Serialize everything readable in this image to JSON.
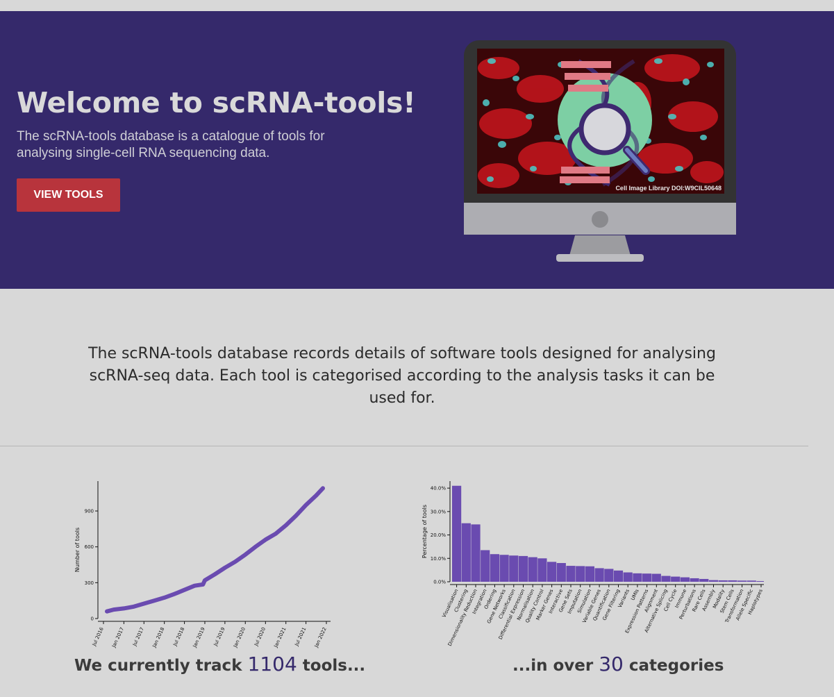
{
  "hero": {
    "title": "Welcome to scRNA-tools!",
    "description": "The scRNA-tools database is a catalogue of tools for analysing single-cell RNA sequencing data.",
    "button_label": "VIEW TOOLS",
    "image_credit": "Cell Image Library DOI:W9CIL50648",
    "background_color": "#35296b",
    "button_color": "#b8343c"
  },
  "intro": {
    "text": "The scRNA-tools database records details of software tools designed for analysing scRNA-seq data. Each tool is categorised according to the analysis tasks it can be used for."
  },
  "captions": {
    "tools_prefix": "We currently track ",
    "tools_count": "1104",
    "tools_suffix": " tools...",
    "categories_prefix": "...in over ",
    "categories_count": "30",
    "categories_suffix": " categories"
  },
  "chart_data": [
    {
      "type": "line",
      "ylabel": "Number of tools",
      "xlabel": "",
      "x_ticks": [
        "Jul 2016",
        "Jan 2017",
        "Jul 2017",
        "Jan 2018",
        "Jul 2018",
        "Jan 2019",
        "Jul 2019",
        "Jan 2020",
        "Jul 2020",
        "Jan 2021",
        "Jul 2021",
        "Jan 2022"
      ],
      "y_ticks": [
        "0",
        "300",
        "600",
        "900"
      ],
      "ylim": [
        0,
        1150
      ],
      "color": "#6a4bb0",
      "series": [
        {
          "x": [
            "2016-08-01",
            "2016-10-01",
            "2017-01-01",
            "2017-04-01",
            "2017-07-01",
            "2017-10-01",
            "2018-01-01",
            "2018-04-01",
            "2018-07-01",
            "2018-10-01",
            "2018-12-15",
            "2019-01-01",
            "2019-04-01",
            "2019-07-01",
            "2019-10-01",
            "2020-01-01",
            "2020-04-01",
            "2020-07-01",
            "2020-10-01",
            "2021-01-01",
            "2021-04-01",
            "2021-07-01",
            "2021-10-01",
            "2021-12-01"
          ],
          "y": [
            60,
            75,
            85,
            100,
            125,
            150,
            175,
            205,
            240,
            275,
            285,
            320,
            370,
            425,
            475,
            535,
            600,
            660,
            710,
            780,
            860,
            950,
            1030,
            1090
          ]
        }
      ]
    },
    {
      "type": "bar",
      "ylabel": "Percentage of tools",
      "xlabel": "",
      "y_ticks": [
        "0.0%",
        "10.0%",
        "20.0%",
        "30.0%",
        "40.0%"
      ],
      "ylim": [
        0,
        43
      ],
      "color": "#6a4bb0",
      "categories": [
        "Visualisation",
        "Clustering",
        "Dimensionality Reduction",
        "Integration",
        "Ordering",
        "Gene Networks",
        "Classification",
        "Differential Expression",
        "Normalisation",
        "Quality Control",
        "Marker Genes",
        "Interactive",
        "Gene Sets",
        "Imputation",
        "Simulation",
        "Variable Genes",
        "Quantification",
        "Gene Filtering",
        "Variants",
        "UMIs",
        "Expression Patterns",
        "Alignment",
        "Alternative Splicing",
        "Cell Cycle",
        "Immune",
        "Perturbations",
        "Rare Cells",
        "Assembly",
        "Modality",
        "Stem Cells",
        "Transformation",
        "Allele Specific",
        "Haplotypes"
      ],
      "values": [
        41,
        25,
        24.5,
        13.5,
        11.8,
        11.5,
        11.2,
        11,
        10.5,
        10,
        8.5,
        8,
        6.8,
        6.7,
        6.6,
        5.8,
        5.5,
        4.8,
        4,
        3.6,
        3.5,
        3.4,
        2.5,
        2.2,
        1.9,
        1.5,
        1.2,
        0.7,
        0.6,
        0.6,
        0.5,
        0.5,
        0.3
      ]
    }
  ]
}
